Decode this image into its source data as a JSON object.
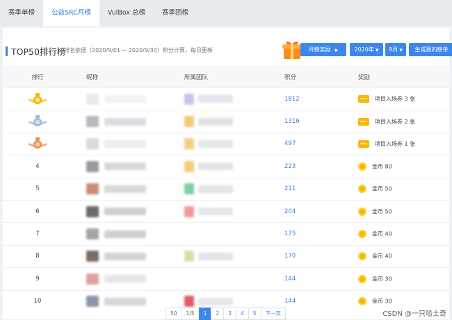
{
  "tabs": [
    {
      "label": "赛季单榜",
      "active": false
    },
    {
      "label": "公益SRC月榜",
      "active": true
    },
    {
      "label": "VulBox 总榜",
      "active": false
    },
    {
      "label": "赛季团榜",
      "active": false
    }
  ],
  "header": {
    "title": "TOP50排行榜",
    "subtitle": "排名依据（2020/9/01 ~ 2020/9/30）积分计算，每日更新",
    "monthly_reward_label": "月榜奖励",
    "year_select": "2020年",
    "month_select": "9月",
    "generate_label": "生成我的榜单"
  },
  "table": {
    "columns": [
      "排行",
      "昵称",
      "所属团队",
      "积分",
      "奖励"
    ],
    "rows": [
      {
        "rank": "",
        "medal": "gold",
        "score": "1812",
        "reward": "项目入场券 3 张",
        "reward_type": "ticket"
      },
      {
        "rank": "",
        "medal": "silver",
        "score": "1316",
        "reward": "项目入场券 2 张",
        "reward_type": "ticket"
      },
      {
        "rank": "",
        "medal": "bronze",
        "score": "497",
        "reward": "项目入场券 1 张",
        "reward_type": "ticket"
      },
      {
        "rank": "4",
        "score": "223",
        "reward": "金币 80",
        "reward_type": "coin"
      },
      {
        "rank": "5",
        "score": "211",
        "reward": "金币 50",
        "reward_type": "coin"
      },
      {
        "rank": "6",
        "score": "204",
        "reward": "金币 50",
        "reward_type": "coin"
      },
      {
        "rank": "7",
        "score": "175",
        "reward": "金币 40",
        "reward_type": "coin"
      },
      {
        "rank": "8",
        "score": "170",
        "reward": "金币 40",
        "reward_type": "coin"
      },
      {
        "rank": "9",
        "score": "144",
        "reward": "金币 30",
        "reward_type": "coin"
      },
      {
        "rank": "10",
        "score": "144",
        "reward": "金币 30",
        "reward_type": "coin"
      }
    ]
  },
  "pagination": {
    "page_size": "50",
    "page_info": "1/5",
    "pages": [
      "1",
      "2",
      "3",
      "4",
      "5"
    ],
    "current": "1",
    "next_label": "下一页"
  },
  "watermark": "CSDN @一只哈士奇",
  "colors": {
    "accent": "#3d87ea",
    "gold": "#f5b800",
    "silver": "#9fb8d6",
    "bronze": "#e8904a"
  }
}
